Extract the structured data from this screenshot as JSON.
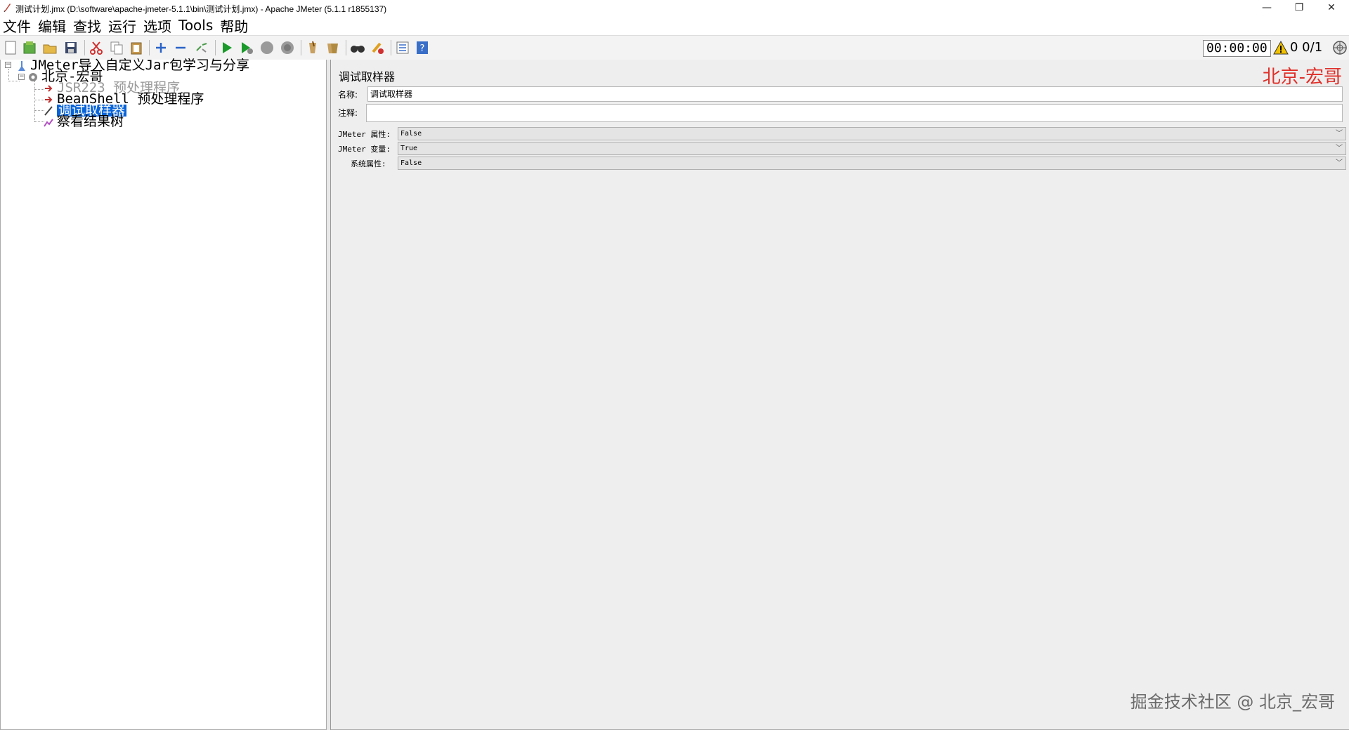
{
  "window": {
    "title": "测试计划.jmx (D:\\software\\apache-jmeter-5.1.1\\bin\\测试计划.jmx) - Apache JMeter (5.1.1 r1855137)",
    "minimize_glyph": "—",
    "maximize_glyph": "❐",
    "close_glyph": "✕"
  },
  "menu": {
    "items": [
      {
        "label": "文件"
      },
      {
        "label": "编辑"
      },
      {
        "label": "查找"
      },
      {
        "label": "运行"
      },
      {
        "label": "选项"
      },
      {
        "label": "Tools"
      },
      {
        "label": "帮助"
      }
    ]
  },
  "toolbar": {
    "icons": [
      "new-icon",
      "templates-icon",
      "open-icon",
      "save-icon",
      "cut-icon",
      "copy-icon",
      "paste-icon",
      "expand-icon",
      "collapse-icon",
      "toggle-icon",
      "start-icon",
      "start-no-pause-icon",
      "stop-icon",
      "shutdown-icon",
      "clear-icon",
      "clear-all-icon",
      "search-icon",
      "reset-search-icon",
      "function-helper-icon",
      "help-icon"
    ],
    "timer": "00:00:00",
    "counts": "0  0/1",
    "colors": {
      "start": "#1a9a2a",
      "cut": "#d03030",
      "help": "#3a6fc8",
      "warning": "#f2c200"
    }
  },
  "tree": {
    "root": "JMeter导入自定义Jar包学习与分享",
    "thread_group": "北京-宏哥",
    "children": [
      {
        "label": "JSR223 预处理程序",
        "state": "disabled"
      },
      {
        "label": "BeanShell 预处理程序",
        "state": "normal"
      },
      {
        "label": "调试取样器",
        "state": "selected"
      },
      {
        "label": "察看结果树",
        "state": "normal"
      }
    ]
  },
  "panel": {
    "title": "调试取样器",
    "watermark_top": "北京-宏哥",
    "name_label": "名称:",
    "name_value": "调试取样器",
    "comment_label": "注释:",
    "comment_value": "",
    "jmeter_props_label": "JMeter 属性:",
    "jmeter_props_value": "False",
    "jmeter_vars_label": "JMeter 变量:",
    "jmeter_vars_value": "True",
    "system_props_label": "系统属性:",
    "system_props_value": "False",
    "watermark_bottom": "掘金技术社区 @ 北京_宏哥"
  }
}
